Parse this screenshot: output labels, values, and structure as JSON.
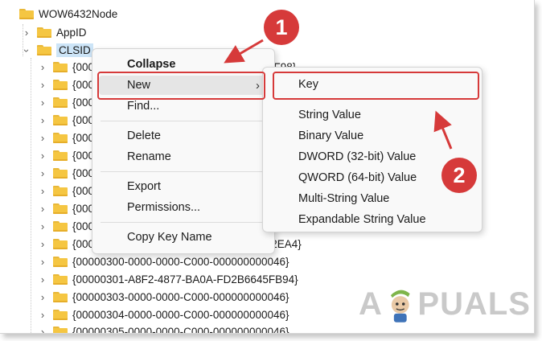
{
  "tree": {
    "root": "WOW6432Node",
    "appid": "AppID",
    "clsid": "CLSID",
    "partial_items": [
      "{000",
      "{000",
      "{000",
      "{000",
      "{000",
      "{000",
      "{000",
      "{000",
      "{000",
      "{000",
      "{000"
    ],
    "tail_item_1": "397F98}",
    "tail_item_11": "6D2EA4}",
    "full_items": [
      "{00000300-0000-0000-C000-000000000046}",
      "{00000301-A8F2-4877-BA0A-FD2B6645FB94}",
      "{00000303-0000-0000-C000-000000000046}",
      "{00000304-0000-0000-C000-000000000046}",
      "{00000305-0000-0000-C000-000000000046}"
    ]
  },
  "context_menu": {
    "collapse": "Collapse",
    "new": "New",
    "find": "Find...",
    "delete": "Delete",
    "rename": "Rename",
    "export": "Export",
    "permissions": "Permissions...",
    "copy_key_name": "Copy Key Name"
  },
  "submenu": {
    "key": "Key",
    "string_value": "String Value",
    "binary_value": "Binary Value",
    "dword": "DWORD (32-bit) Value",
    "qword": "QWORD (64-bit) Value",
    "multi_string": "Multi-String Value",
    "expandable_string": "Expandable String Value"
  },
  "annotations": {
    "step1": "1",
    "step2": "2",
    "accent_color": "#d63a3a"
  },
  "watermark": {
    "text_left": "A",
    "text_right": "PUALS"
  },
  "icons": {
    "folder": "folder-icon",
    "expand": "chevron-right-icon",
    "collapse": "chevron-down-icon",
    "submenu": "chevron-right-icon"
  }
}
